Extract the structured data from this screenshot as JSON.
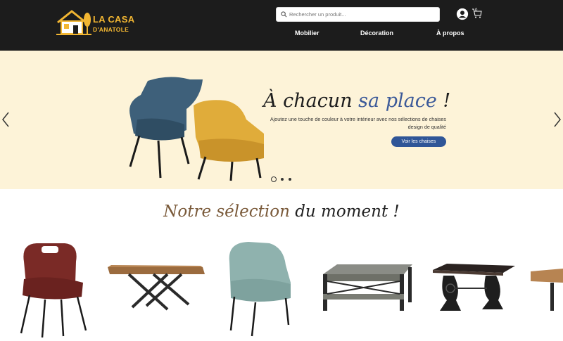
{
  "header": {
    "logo_line1": "LA CASA",
    "logo_line2": "D'ANATOLE",
    "search_placeholder": "Rechercher un produit...",
    "cart_count": "0",
    "nav": [
      "Mobilier",
      "Décoration",
      "À propos"
    ]
  },
  "hero": {
    "title_part1": "À chacun ",
    "title_accent": "sa place",
    "title_part2": " !",
    "subtitle": "Ajoutez une touche de couleur à votre intérieur avec nos sélections de chaises design de qualité",
    "button_label": "Voir les chaises",
    "slides_count": 3,
    "active_slide": 1
  },
  "selection": {
    "title_accent": "Notre sélection",
    "title_rest": " du moment !"
  },
  "colors": {
    "header_bg": "#1c1c1c",
    "brand_yellow": "#f2b632",
    "hero_bg": "#fdf3d8",
    "button_blue": "#2f5597",
    "accent_blue": "#3c5a99",
    "accent_brown": "#7a5a3a"
  },
  "icons": [
    "search-icon",
    "user-icon",
    "cart-icon",
    "chevron-left-icon",
    "chevron-right-icon"
  ]
}
